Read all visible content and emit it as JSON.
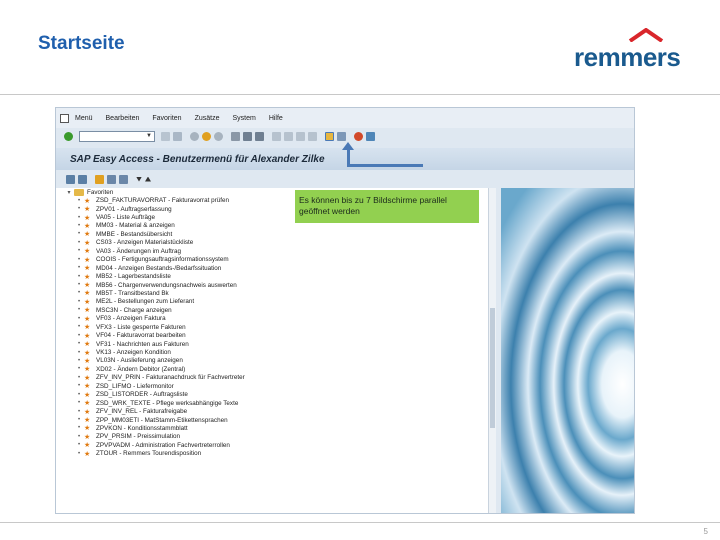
{
  "slide": {
    "title": "Startseite",
    "logo_text": "remmers",
    "page_number": "5"
  },
  "sap": {
    "menu": [
      "Menü",
      "Bearbeiten",
      "Favoriten",
      "Zusätze",
      "System",
      "Hilfe"
    ],
    "window_title": "SAP Easy Access  -  Benutzermenü für Alexander Zilke",
    "tree_root": "Favoriten",
    "favorites": [
      "ZSD_FAKTURAVORRAT - Fakturavorrat prüfen",
      "ZPV01 - Auftragserfassung",
      "VA05 - Liste Aufträge",
      "MM03 - Material & anzeigen",
      "MMBE - Bestandsübersicht",
      "CS03 - Anzeigen Materialstückliste",
      "VA03 - Änderungen im Auftrag",
      "COOIS - Fertigungsauftragsinformationssystem",
      "MD04 - Anzeigen Bestands-/Bedarfssituation",
      "MB52 - Lagerbestandsliste",
      "MB56 - Chargenverwendungsnachweis auswerten",
      "MB5T - Transitbestand Bk",
      "ME2L - Bestellungen zum Lieferant",
      "MSC3N - Charge anzeigen",
      "VF03 - Anzeigen Faktura",
      "VFX3 - Liste gesperrte Fakturen",
      "VF04 - Fakturavorrat bearbeiten",
      "VF31 - Nachrichten aus Fakturen",
      "VK13 - Anzeigen Kondition",
      "VL03N - Auslieferung anzeigen",
      "XD02 - Ändern Debitor (Zentral)",
      "ZFV_INV_PRIN - Fakturanachdruck für Fachvertreter",
      "ZSD_LIFMO - Liefermonitor",
      "ZSD_LISTORDER - Auftragsliste",
      "ZSD_WRK_TEXTE - Pflege werksabhängige Texte",
      "ZFV_INV_REL - Fakturafreigabe",
      "ZPP_MM03ETI - MatStamm-Etikettensprachen",
      "ZPVKON - Konditionsstammblatt",
      "ZPV_PRSIM - Preissimulation",
      "ZPVPVADM - Administration Fachvertreterrollen",
      "ZTOUR - Remmers Tourendisposition"
    ]
  },
  "callout": {
    "text": "Es können bis zu 7 Bildschirme parallel geöffnet werden"
  },
  "colors": {
    "title_blue": "#1f5fad",
    "logo_blue": "#1a5a8e",
    "logo_roof_red": "#d9262b",
    "callout_green": "#92d050",
    "arrow_blue": "#4a79b6"
  }
}
